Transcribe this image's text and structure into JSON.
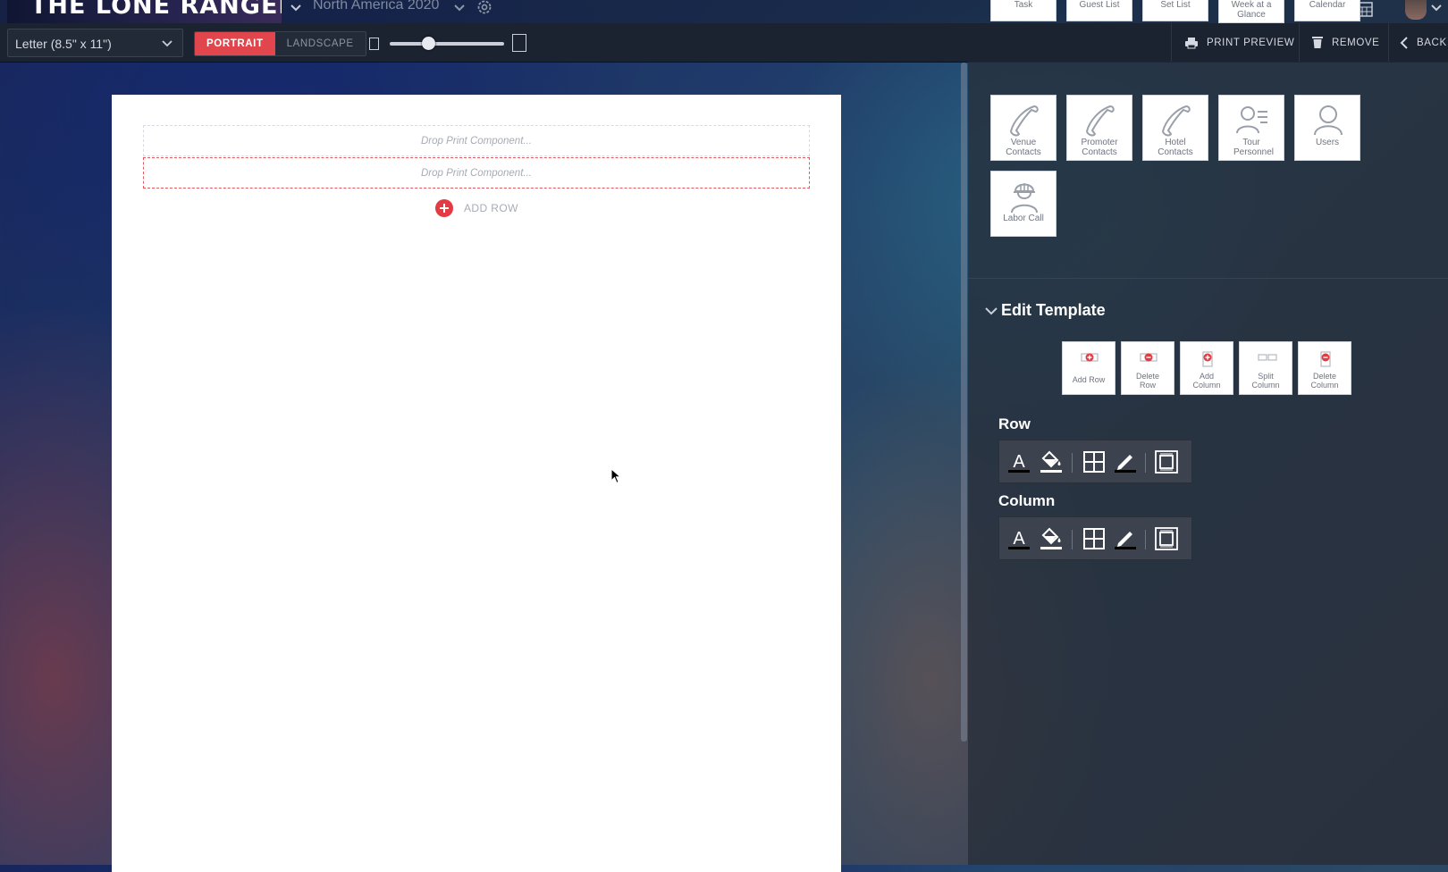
{
  "header": {
    "brand": "THE LONE RANGERS",
    "tour": "North America 2020"
  },
  "toolbar": {
    "paper_size": "Letter (8.5\" x 11\")",
    "orientation_portrait": "PORTRAIT",
    "orientation_landscape": "LANDSCAPE",
    "zoom_level": 0.3,
    "print_preview": "PRINT PREVIEW",
    "remove": "REMOVE",
    "back": "BACK"
  },
  "page": {
    "drop_placeholder_1": "Drop Print Component...",
    "drop_placeholder_2": "Drop Print Component...",
    "add_row": "ADD ROW"
  },
  "components": {
    "top_row": [
      "Task",
      "Guest List",
      "Set List",
      "Week at a Glance",
      "Calendar"
    ],
    "venue_contacts": "Venue Contacts",
    "promoter_contacts": "Promoter Contacts",
    "hotel_contacts": "Hotel Contacts",
    "tour_personnel": "Tour Personnel",
    "users": "Users",
    "labor_call": "Labor Call"
  },
  "edit_template": {
    "title": "Edit Template",
    "add_row": "Add Row",
    "delete_row": "Delete Row",
    "add_column": "Add Column",
    "split_column": "Split Column",
    "delete_column": "Delete Column"
  },
  "format": {
    "row_label": "Row",
    "column_label": "Column"
  },
  "colors": {
    "accent": "#e0464c",
    "toolbar_bg": "#1b2230",
    "panel_bg": "#262e3a"
  }
}
